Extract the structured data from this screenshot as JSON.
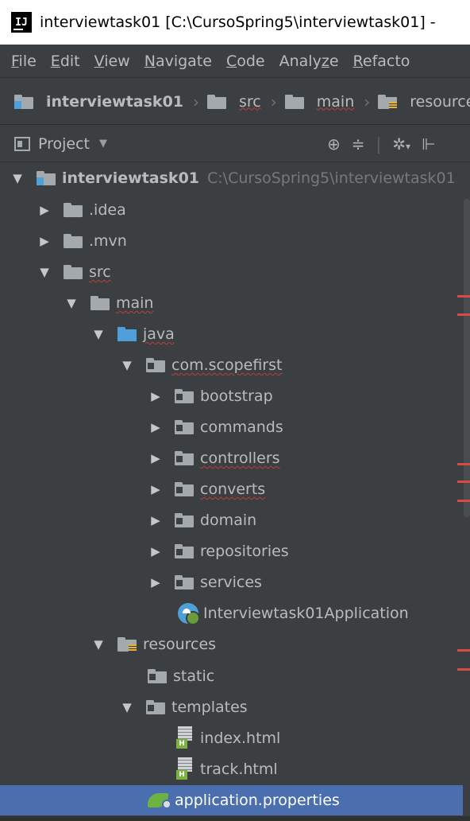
{
  "window": {
    "app_icon": "intellij-logo-icon",
    "app_icon_text": "IJ",
    "title": "interviewtask01 [C:\\CursoSpring5\\interviewtask01] -"
  },
  "menu": {
    "items": [
      {
        "mnemonic": "F",
        "rest": "ile"
      },
      {
        "mnemonic": "E",
        "rest": "dit"
      },
      {
        "mnemonic": "V",
        "rest": "iew"
      },
      {
        "mnemonic": "N",
        "rest": "avigate"
      },
      {
        "mnemonic": "C",
        "rest": "ode"
      },
      {
        "pre": "Analy",
        "mnemonic": "z",
        "rest": "e"
      },
      {
        "mnemonic": "R",
        "rest": "efacto"
      }
    ]
  },
  "breadcrumb": {
    "items": [
      "interviewtask01",
      "src",
      "main",
      "resource"
    ]
  },
  "project_panel": {
    "title": "Project",
    "caret": "▼",
    "tools": {
      "locate": "⊕",
      "collapse": "≑",
      "separator": "|",
      "settings": "✲",
      "settings_caret": "▾",
      "hide": "⊩"
    }
  },
  "tree": {
    "root": {
      "label": "interviewtask01",
      "path": "C:\\CursoSpring5\\interviewtask01"
    },
    "idea": ".idea",
    "mvn": ".mvn",
    "src": "src",
    "main": "main",
    "java": "java",
    "package": "com.scopefirst",
    "bootstrap": "bootstrap",
    "commands": "commands",
    "controllers": "controllers",
    "converts": "converts",
    "domain": "domain",
    "repositories": "repositories",
    "services": "services",
    "app_class": "Interviewtask01Application",
    "resources": "resources",
    "static": "static",
    "templates": "templates",
    "index_html": "index.html",
    "track_html": "track.html",
    "app_properties": "application.properties",
    "html_badge": "H",
    "arrow_expanded": "▼",
    "arrow_collapsed": "▶"
  },
  "colors": {
    "background": "#3c3f41",
    "text": "#bbbbbb",
    "selection": "#4b6eaf",
    "error": "#d84a43",
    "folder_gray": "#a3a9ad",
    "folder_blue": "#4fa0d8",
    "spring_green": "#6db33f"
  }
}
